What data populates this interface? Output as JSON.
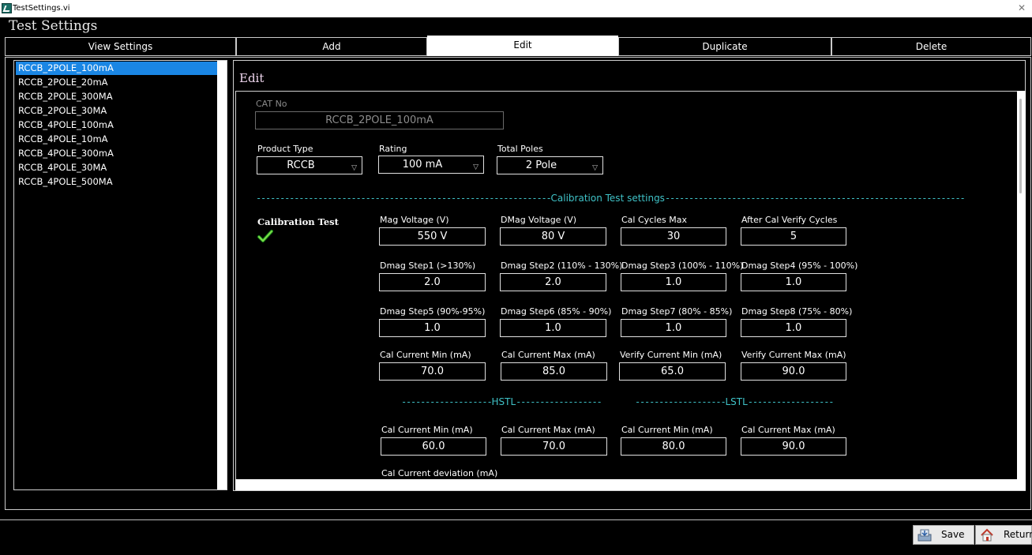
{
  "window": {
    "title": "TestSettings.vi"
  },
  "page_title": "Test Settings",
  "tabs": [
    {
      "label": "View Settings"
    },
    {
      "label": "Add"
    },
    {
      "label": "Edit"
    },
    {
      "label": "Duplicate"
    },
    {
      "label": "Delete"
    }
  ],
  "list": {
    "selected_index": 0,
    "items": [
      "RCCB_2POLE_100mA",
      "RCCB_2POLE_20mA",
      "RCCB_2POLE_300MA",
      "RCCB_2POLE_30MA",
      "RCCB_4POLE_100mA",
      "RCCB_4POLE_10mA",
      "RCCB_4POLE_300mA",
      "RCCB_4POLE_30MA",
      "RCCB_4POLE_500MA"
    ]
  },
  "edit": {
    "title": "Edit",
    "cat_no": {
      "label": "CAT No",
      "value": "RCCB_2POLE_100mA"
    },
    "product_type": {
      "label": "Product Type",
      "value": "RCCB"
    },
    "rating": {
      "label": "Rating",
      "value": "100 mA"
    },
    "total_poles": {
      "label": "Total Poles",
      "value": "2 Pole"
    },
    "calibration_header": "Calibration Test settings",
    "calibration_test_label": "Calibration Test",
    "row1": [
      {
        "label": "Mag Voltage (V)",
        "value": "550 V"
      },
      {
        "label": "DMag Voltage (V)",
        "value": "80 V"
      },
      {
        "label": "Cal Cycles Max",
        "value": "30"
      },
      {
        "label": "After Cal Verify Cycles",
        "value": "5"
      }
    ],
    "row2": [
      {
        "label": "Dmag Step1 (>130%)",
        "value": "2.0"
      },
      {
        "label": "Dmag Step2 (110% - 130%)",
        "value": "2.0"
      },
      {
        "label": "Dmag Step3 (100% - 110%)",
        "value": "1.0"
      },
      {
        "label": "Dmag Step4 (95% - 100%)",
        "value": "1.0"
      }
    ],
    "row3": [
      {
        "label": "Dmag Step5 (90%-95%)",
        "value": "1.0"
      },
      {
        "label": "Dmag Step6 (85% - 90%)",
        "value": "1.0"
      },
      {
        "label": "Dmag Step7 (80% - 85%)",
        "value": "1.0"
      },
      {
        "label": "Dmag Step8 (75% - 80%)",
        "value": "1.0"
      }
    ],
    "row4": [
      {
        "label": "Cal Current Min (mA)",
        "value": "70.0"
      },
      {
        "label": "Cal Current Max (mA)",
        "value": "85.0"
      },
      {
        "label": "Verify Current Min (mA)",
        "value": "65.0"
      },
      {
        "label": "Verify Current Max (mA)",
        "value": "90.0"
      }
    ],
    "hstl_header": "HSTL",
    "lstl_header": "LSTL",
    "row5": [
      {
        "label": "Cal Current Min (mA)",
        "value": "60.0"
      },
      {
        "label": "Cal Current Max (mA)",
        "value": "70.0"
      },
      {
        "label": "Cal Current Min (mA)",
        "value": "80.0"
      },
      {
        "label": "Cal Current Max (mA)",
        "value": "90.0"
      }
    ],
    "deviation_label": "Cal Current deviation (mA)"
  },
  "footer": {
    "save_label": "Save",
    "return_label": "Return"
  },
  "icons": {
    "check": "check-icon",
    "save": "save-icon",
    "return": "home-icon"
  },
  "colors": {
    "accent_cyan": "#3fc2c7",
    "selection_blue": "#1a86e4"
  }
}
